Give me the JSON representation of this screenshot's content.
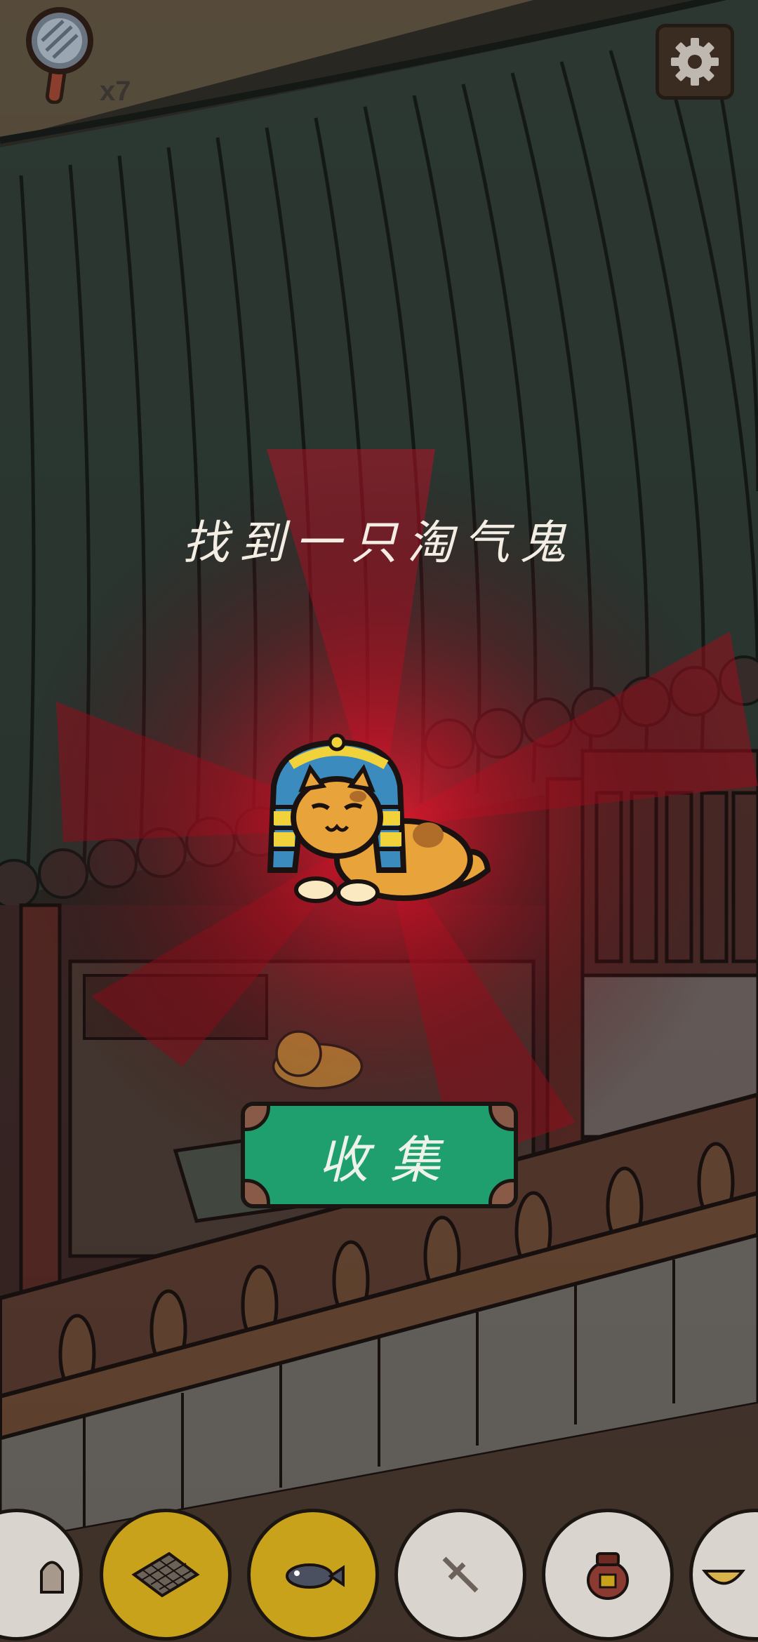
{
  "hud": {
    "hint_count": "x7"
  },
  "popup": {
    "message": "找到一只淘气鬼",
    "collect_label": "收集"
  },
  "tray": {
    "slots": [
      {
        "icon": "ghost-icon",
        "found": false
      },
      {
        "icon": "go-board-icon",
        "found": true
      },
      {
        "icon": "fish-icon",
        "found": true
      },
      {
        "icon": "dagger-icon",
        "found": false
      },
      {
        "icon": "pot-icon",
        "found": false
      },
      {
        "icon": "bowl-icon",
        "found": false
      }
    ]
  },
  "colors": {
    "button_green": "#1f9f6e",
    "glow_red": "#e0102a",
    "slot_found": "#c9a21c",
    "slot_empty": "#d9d4cd"
  }
}
